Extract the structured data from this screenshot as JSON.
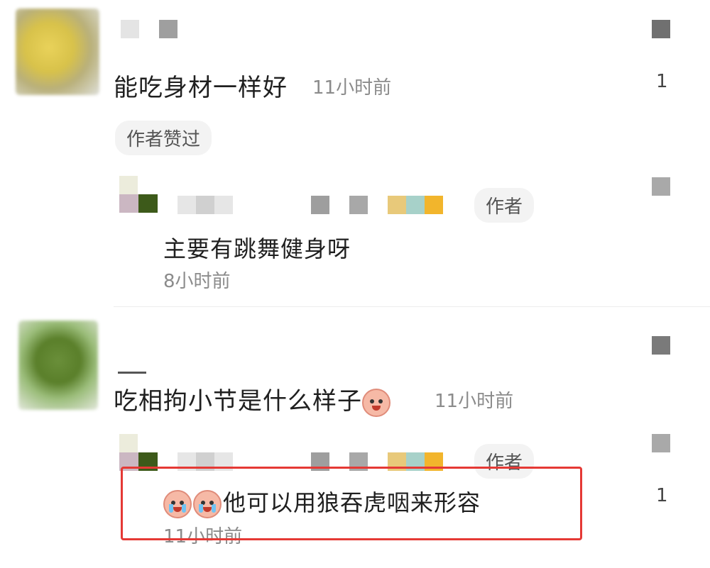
{
  "comments": [
    {
      "text": "能吃身材一样好",
      "time": "11小时前",
      "badge": "作者赞过",
      "likes": "1",
      "reply": {
        "author_tag": "作者",
        "text": "主要有跳舞健身呀",
        "time": "8小时前"
      }
    },
    {
      "text": "吃相拘小节是什么样子",
      "time": "11小时前",
      "reply": {
        "author_tag": "作者",
        "text": "他可以用狼吞虎咽来形容",
        "time": "11小时前",
        "likes": "1"
      }
    }
  ],
  "colors": {
    "highlight": "#e53935",
    "time_text": "#8b8b8b"
  }
}
